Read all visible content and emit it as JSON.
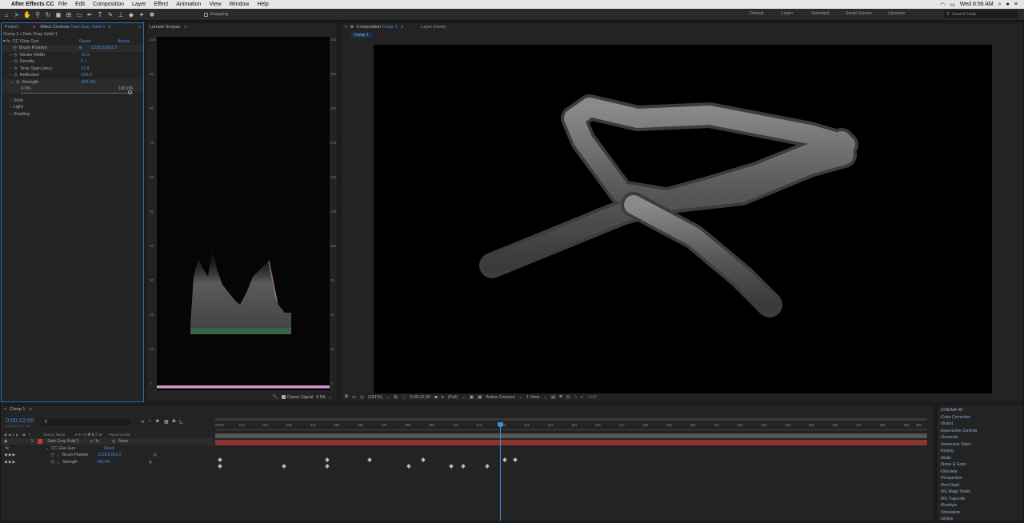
{
  "menubar": {
    "app": "After Effects CC",
    "items": [
      "File",
      "Edit",
      "Composition",
      "Layer",
      "Effect",
      "Animation",
      "View",
      "Window",
      "Help"
    ],
    "clock": "Wed 8:56 AM"
  },
  "toolbar": {
    "snapping": "Snapping",
    "workspaces": [
      "Default",
      "Learn",
      "Standard",
      "Small Screen",
      "Libraries"
    ],
    "search_placeholder": "Search Help"
  },
  "effect_controls": {
    "tab_project": "Project",
    "tab_effect": "Effect Controls",
    "tab_layer": "Dark Gray Solid 1",
    "path": "Comp 1 • Dark Gray Solid 1",
    "effect_name": "CC Glue Gun",
    "reset": "Reset",
    "about": "About...",
    "params": [
      {
        "label": "Brush Position",
        "value": "1229.8,802.0"
      },
      {
        "label": "Stroke Width",
        "value": "15.9"
      },
      {
        "label": "Density",
        "value": "0.1"
      },
      {
        "label": "Time Span (sec)",
        "value": "11.8"
      },
      {
        "label": "Reflection",
        "value": "100.0"
      },
      {
        "label": "Strength",
        "value": "100.0%"
      }
    ],
    "slider_min": "0.0%",
    "slider_max": "100.0%",
    "groups": [
      "Style",
      "Light",
      "Shading"
    ]
  },
  "scopes": {
    "tab": "Lumetri Scopes",
    "left_ticks": [
      "100",
      "90",
      "80",
      "70",
      "60",
      "50",
      "40",
      "30",
      "20",
      "10",
      "0"
    ],
    "right_ticks": [
      "255",
      "230",
      "204",
      "178",
      "153",
      "128",
      "102",
      "76",
      "51",
      "26",
      "0"
    ],
    "clamp": "Clamp Signal",
    "bit": "8 Bit"
  },
  "comp": {
    "tab": "Composition",
    "comp_name": "Comp 1",
    "layer_tab": "Layer (none)",
    "subtab": "Comp 1",
    "zoom": "(161%)",
    "timecode": "0;00;12;00",
    "quality": "(Full)",
    "camera": "Active Camera",
    "views": "1 View",
    "exposure": "+0.0"
  },
  "timeline": {
    "tab": "Comp 1",
    "timecode": "0;00;12;00",
    "fps": "00360 (29.97 fps)",
    "col_source": "Source Name",
    "col_parent": "Parent & Link",
    "layer_num": "1",
    "layer_name": "Dark Gray Solid 1",
    "parent": "None",
    "effect": "CC Glue Gun",
    "reset": "Reset",
    "props": [
      {
        "label": "Brush Position",
        "value": "1229.8,802.0"
      },
      {
        "label": "Strength",
        "value": "100.0%"
      }
    ],
    "ruler": [
      "0:00s",
      "01s",
      "02s",
      "03s",
      "04s",
      "05s",
      "06s",
      "07s",
      "08s",
      "09s",
      "10s",
      "11s",
      "12s",
      "13s",
      "14s",
      "15s",
      "16s",
      "17s",
      "18s",
      "19s",
      "20s",
      "21s",
      "22s",
      "23s",
      "24s",
      "25s",
      "26s",
      "27s",
      "28s",
      "29s",
      "30s"
    ],
    "playhead_fraction": 0.4,
    "keys_position": [
      0,
      0.15,
      0.21,
      0.285,
      0.4,
      0.415
    ],
    "keys_strength": [
      0,
      0.09,
      0.15,
      0.265,
      0.325,
      0.342,
      0.375
    ]
  },
  "effects_presets": {
    "items": [
      "CINEMA 4D",
      "Color Correction",
      "Distort",
      "Expression Controls",
      "Generate",
      "Immersive Video",
      "Keying",
      "Matte",
      "Noise & Grain",
      "Obsolete",
      "Perspective",
      "Red Giant",
      "RG Magic Bullet",
      "RG Trapcode",
      "Rowbyte",
      "Simulation",
      "Stylize"
    ]
  }
}
